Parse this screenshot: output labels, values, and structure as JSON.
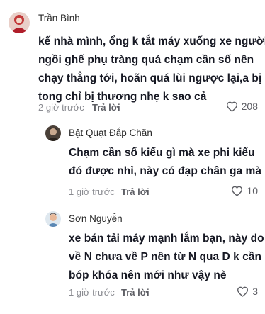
{
  "comments": [
    {
      "username": "Trần Bình",
      "text_lines": [
        "kế nhà mình, ổng k tắt máy xuống xe người",
        "ngồi ghế phụ tràng quá chạm cần số nên",
        "chạy thẳng tới, hoãn quá lùi ngược lại,a bị",
        "tong chỉ bị thương nhẹ k sao cả"
      ],
      "time": "2 giờ trước",
      "reply_label": "Trả lời",
      "likes": "208"
    },
    {
      "username": "Bật Quạt Đắp Chăn",
      "text_lines": [
        "Chạm cần số kiểu gì mà xe phi kiểu",
        "đó được nhỉ, này có đạp chân ga mà"
      ],
      "time": "1 giờ trước",
      "reply_label": "Trả lời",
      "likes": "10"
    },
    {
      "username": "Sơn Nguyễn",
      "text_lines": [
        "xe bán tải máy mạnh lắm bạn, này do",
        "về N chưa về P nên từ N qua D k cần",
        "bóp khóa nên mới như vậy nè"
      ],
      "time": "1 giờ trước",
      "reply_label": "Trả lời",
      "likes": "3"
    }
  ],
  "icons": {
    "like": "heart-outline-icon"
  },
  "colors": {
    "text": "#161823",
    "meta": "#8a8b91",
    "reply": "#5c5d63"
  }
}
